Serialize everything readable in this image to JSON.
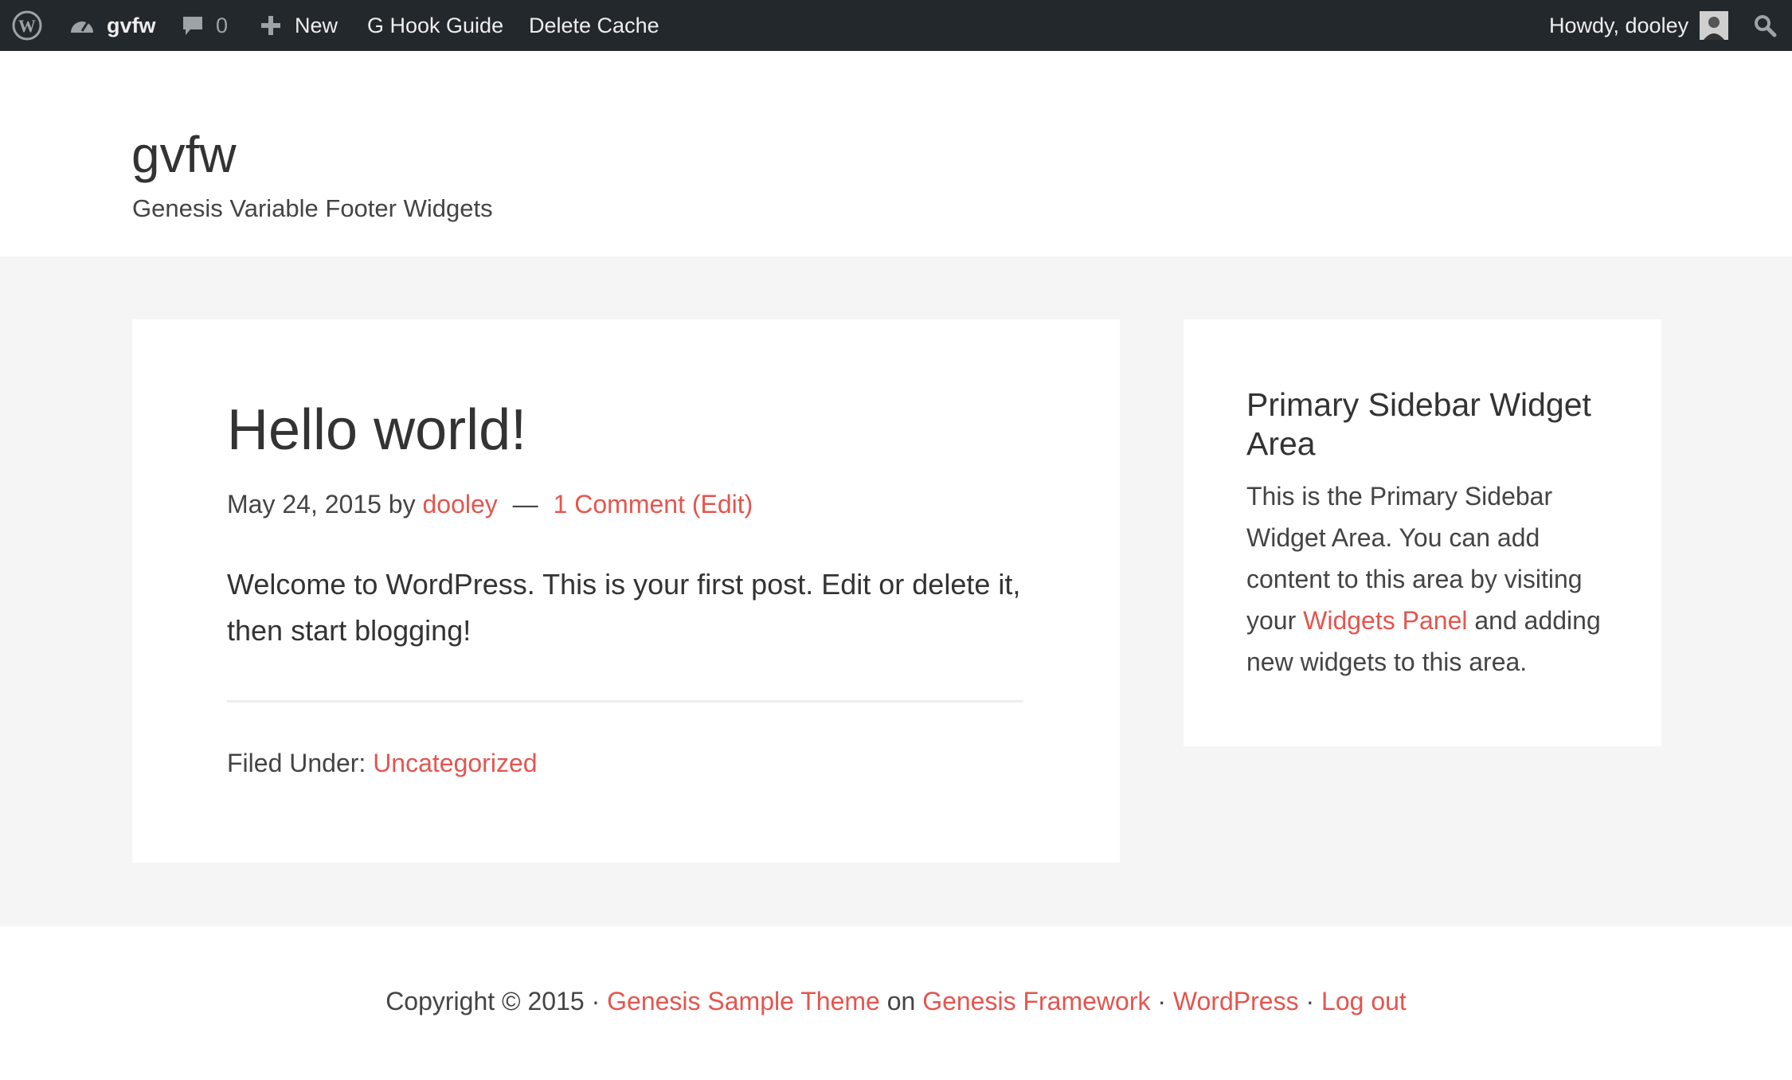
{
  "admin_bar": {
    "site_name": "gvfw",
    "comments_count": "0",
    "new_label": "New",
    "hook_guide_label": "G Hook Guide",
    "delete_cache_label": "Delete Cache",
    "howdy_label": "Howdy, dooley"
  },
  "header": {
    "site_title": "gvfw",
    "site_description": "Genesis Variable Footer Widgets"
  },
  "post": {
    "title": "Hello world!",
    "date": "May 24, 2015",
    "by": "by",
    "author": "dooley",
    "separator": "—",
    "comments_link": "1 Comment",
    "edit_link": "(Edit)",
    "content": "Welcome to WordPress. This is your first post. Edit or delete it, then start blogging!",
    "filed_under_label": "Filed Under:",
    "category": "Uncategorized"
  },
  "sidebar": {
    "widget_title": "Primary Sidebar Widget Area",
    "text_before": "This is the Primary Sidebar Widget Area. You can add content to this area by visiting your",
    "link": "Widgets Panel",
    "text_after": "and adding new widgets to this area."
  },
  "footer": {
    "copyright": "Copyright © 2015 ·",
    "theme_link": "Genesis Sample Theme",
    "on": "on",
    "framework_link": "Genesis Framework",
    "dot1": "·",
    "wordpress_link": "WordPress",
    "dot2": "·",
    "logout_link": "Log out"
  },
  "colors": {
    "accent": "#e5554e",
    "admin_bar_bg": "#23282d",
    "page_bg": "#f5f5f5"
  },
  "icons": [
    "wordpress-logo-icon",
    "dashboard-icon",
    "comment-icon",
    "plus-icon",
    "avatar",
    "search-icon"
  ]
}
